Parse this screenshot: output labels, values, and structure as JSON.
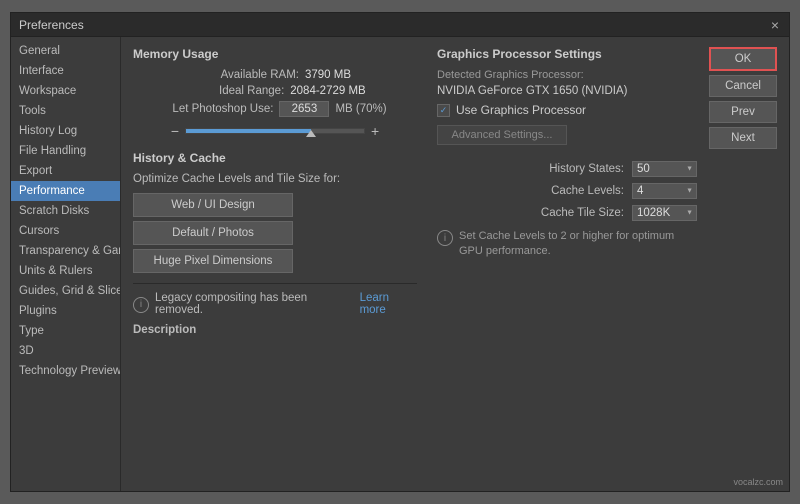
{
  "dialog": {
    "title": "Preferences",
    "close_icon": "×"
  },
  "sidebar": {
    "items": [
      {
        "label": "General",
        "active": false
      },
      {
        "label": "Interface",
        "active": false
      },
      {
        "label": "Workspace",
        "active": false
      },
      {
        "label": "Tools",
        "active": false
      },
      {
        "label": "History Log",
        "active": false
      },
      {
        "label": "File Handling",
        "active": false
      },
      {
        "label": "Export",
        "active": false
      },
      {
        "label": "Performance",
        "active": true
      },
      {
        "label": "Scratch Disks",
        "active": false
      },
      {
        "label": "Cursors",
        "active": false
      },
      {
        "label": "Transparency & Gamut",
        "active": false
      },
      {
        "label": "Units & Rulers",
        "active": false
      },
      {
        "label": "Guides, Grid & Slices",
        "active": false
      },
      {
        "label": "Plugins",
        "active": false
      },
      {
        "label": "Type",
        "active": false
      },
      {
        "label": "3D",
        "active": false
      },
      {
        "label": "Technology Previews",
        "active": false
      }
    ]
  },
  "memory": {
    "section_title": "Memory Usage",
    "available_ram_label": "Available RAM:",
    "available_ram_value": "3790 MB",
    "ideal_range_label": "Ideal Range:",
    "ideal_range_value": "2084-2729 MB",
    "let_photoshop_label": "Let Photoshop Use:",
    "input_value": "2653",
    "mb_label": "MB (70%)",
    "slider_minus": "−",
    "slider_plus": "+"
  },
  "cache": {
    "section_title": "History & Cache",
    "subtitle": "Optimize Cache Levels and Tile Size for:",
    "buttons": [
      "Web / UI Design",
      "Default / Photos",
      "Huge Pixel Dimensions"
    ]
  },
  "gpu": {
    "section_title": "Graphics Processor Settings",
    "detected_label": "Detected Graphics Processor:",
    "detected_value": "NVIDIA GeForce GTX 1650 (NVIDIA)",
    "use_gpu_label": "Use Graphics Processor",
    "use_gpu_checked": true,
    "adv_settings_label": "Advanced Settings..."
  },
  "history_states": {
    "label": "History States:",
    "value": "50"
  },
  "cache_levels": {
    "label": "Cache Levels:",
    "value": "4"
  },
  "cache_tile": {
    "label": "Cache Tile Size:",
    "value": "1028K"
  },
  "gpu_note": {
    "icon": "i",
    "text": "Set Cache Levels to 2 or higher for optimum GPU performance."
  },
  "legacy": {
    "icon": "i",
    "text": "Legacy compositing has been removed.",
    "learn_more": "Learn more"
  },
  "description": {
    "label": "Description"
  },
  "buttons": {
    "ok": "OK",
    "cancel": "Cancel",
    "prev": "Prev",
    "next": "Next"
  },
  "watermark": "vocalzc.com"
}
